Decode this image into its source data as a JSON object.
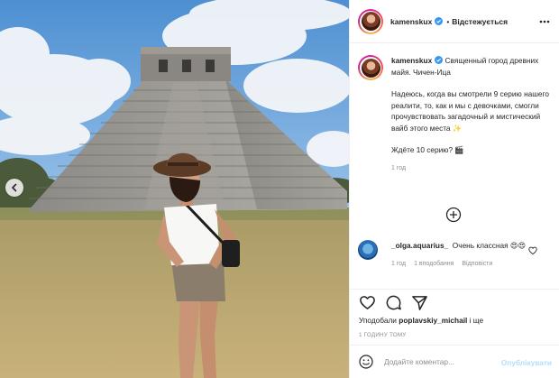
{
  "post": {
    "image_alt": "Woman in a hat standing in front of the Chichen Itza pyramid",
    "colors": {
      "sky": "#6ea4d8",
      "stone": "#8f8e89",
      "grass": "#b9a56c"
    }
  },
  "header": {
    "username": "kamenskux",
    "separator": "•",
    "follow_status": "Відстежується",
    "icons": {
      "verified": "verified-badge-icon",
      "more": "more-options-icon"
    }
  },
  "caption": {
    "username": "kamenskux",
    "first_paragraph": "Священный город древних майя. Чичен-Ица",
    "second_paragraph": "Надеюсь, когда вы смотрели 9 серию нашего реалити, то, как и мы с девочками, смогли прочувствовать загадочный и мистический вайб этого места",
    "sparkle": "✨",
    "third_paragraph": "Ждёте 10 серию? 🎬",
    "time": "1 год"
  },
  "comment": {
    "username": "_olga.aquarius_",
    "text": "Очень классная 😍😍",
    "time": "1 год",
    "likes": "1 вподобання",
    "reply": "Відповісти"
  },
  "actions": {
    "icons": [
      "heart-icon",
      "comment-icon",
      "share-icon"
    ],
    "liked_by_prefix": "Уподобали ",
    "liked_by_user": "poplavskiy_michail",
    "liked_by_suffix": " і ще",
    "post_time": "1 ГОДИНУ ТОМУ"
  },
  "add_comment": {
    "placeholder": "Додайте коментар...",
    "publish_label": "Опублікувати",
    "publish_color": "#b2dffc"
  }
}
